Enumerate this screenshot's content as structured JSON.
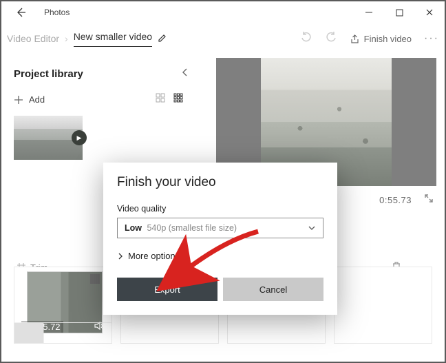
{
  "titlebar": {
    "app_name": "Photos"
  },
  "toolbar": {
    "crumb_root": "Video Editor",
    "crumb_current": "New smaller video",
    "finish_label": "Finish video"
  },
  "library": {
    "title": "Project library",
    "add_label": "Add"
  },
  "preview": {
    "time": "0:55.73"
  },
  "story_controls": {
    "trim_label": "Trim"
  },
  "storyboard": {
    "clip_duration": "55.72"
  },
  "dialog": {
    "title": "Finish your video",
    "quality_label": "Video quality",
    "quality_value_strong": "Low",
    "quality_value_hint": "540p (smallest file size)",
    "more_options": "More options",
    "export_label": "Export",
    "cancel_label": "Cancel"
  }
}
